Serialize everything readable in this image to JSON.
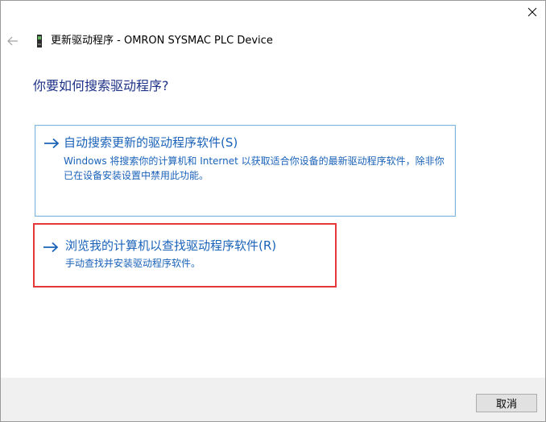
{
  "window": {
    "title": "更新驱动程序 - OMRON SYSMAC PLC Device"
  },
  "main": {
    "heading": "你要如何搜索驱动程序?",
    "options": [
      {
        "title": "自动搜索更新的驱动程序软件(S)",
        "description": "Windows 将搜索你的计算机和 Internet 以获取适合你设备的最新驱动程序软件，除非你已在设备安装设置中禁用此功能。"
      },
      {
        "title": "浏览我的计算机以查找驱动程序软件(R)",
        "description": "手动查找并安装驱动程序软件。"
      }
    ]
  },
  "footer": {
    "cancel_label": "取消"
  },
  "icons": {
    "close": "close-icon",
    "back": "back-arrow-icon",
    "device": "device-icon",
    "option_arrow": "arrow-right-icon"
  },
  "colors": {
    "link_blue": "#1a62b8",
    "heading_blue": "#1e3287",
    "highlight_red": "#e5383b",
    "option_border": "#7fb4dc",
    "footer_bg": "#f0f0f0"
  }
}
